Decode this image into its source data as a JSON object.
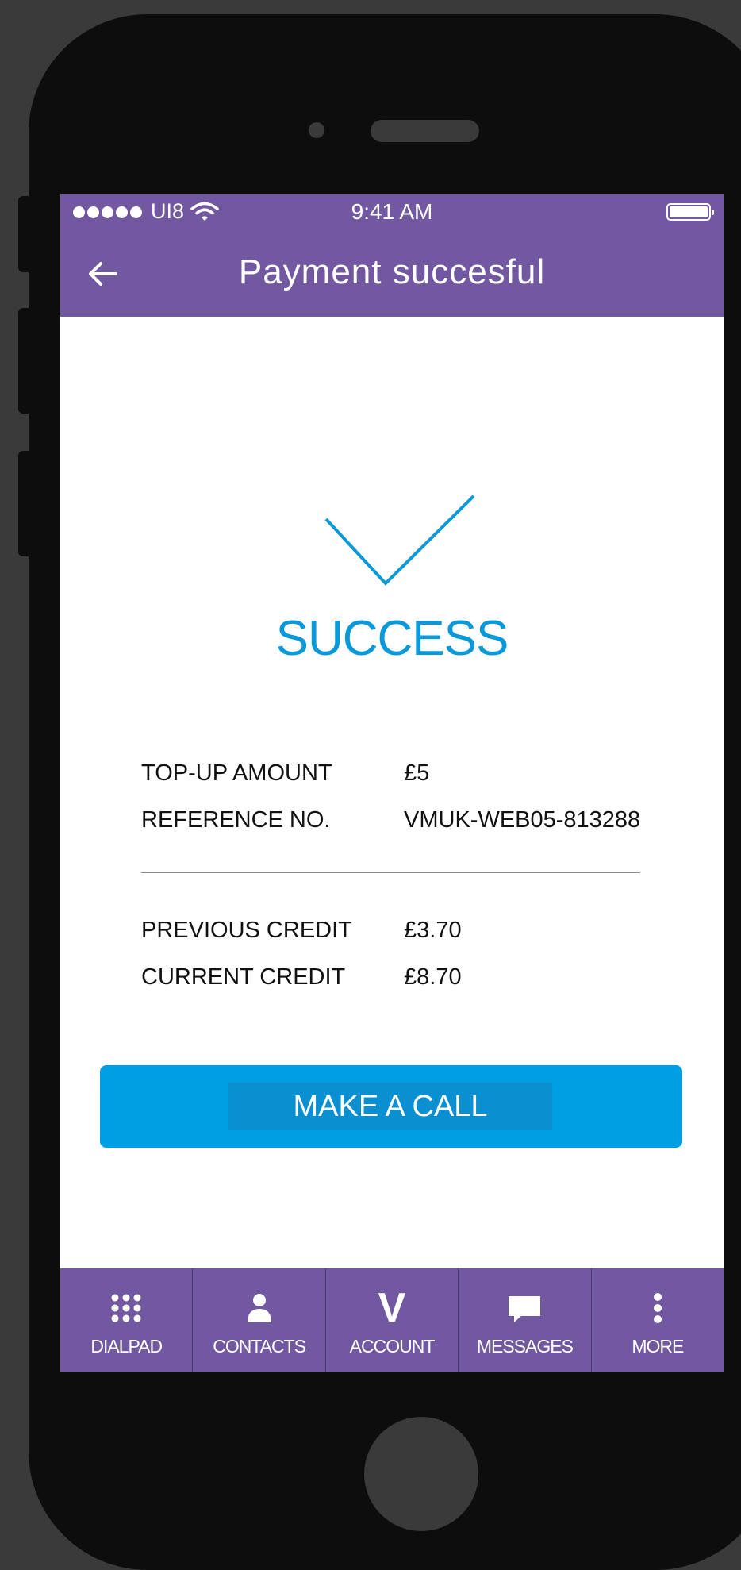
{
  "status_bar": {
    "carrier": "UI8",
    "time": "9:41 AM"
  },
  "header": {
    "title": "Payment succesful"
  },
  "result": {
    "status": "SUCCESS",
    "accent_color": "#0a99d8"
  },
  "details": [
    {
      "label": "TOP-UP  AMOUNT",
      "value": "£5"
    },
    {
      "label": "REFERENCE NO.",
      "value": "VMUK-WEB05-813288"
    }
  ],
  "credit": [
    {
      "label": "PREVIOUS CREDIT",
      "value": "£3.70"
    },
    {
      "label": "CURRENT CREDIT",
      "value": "£8.70"
    }
  ],
  "action": {
    "label": "MAKE A CALL",
    "color": "#009ee2"
  },
  "tabs": [
    {
      "label": "DIALPAD",
      "icon": "dialpad-icon"
    },
    {
      "label": "CONTACTS",
      "icon": "person-icon"
    },
    {
      "label": "ACCOUNT",
      "icon": "v-logo-icon",
      "glyph": "V"
    },
    {
      "label": "MESSAGES",
      "icon": "message-bubble-icon"
    },
    {
      "label": "MORE",
      "icon": "more-vertical-icon"
    }
  ],
  "theme": {
    "brand_purple": "#7258a0"
  }
}
